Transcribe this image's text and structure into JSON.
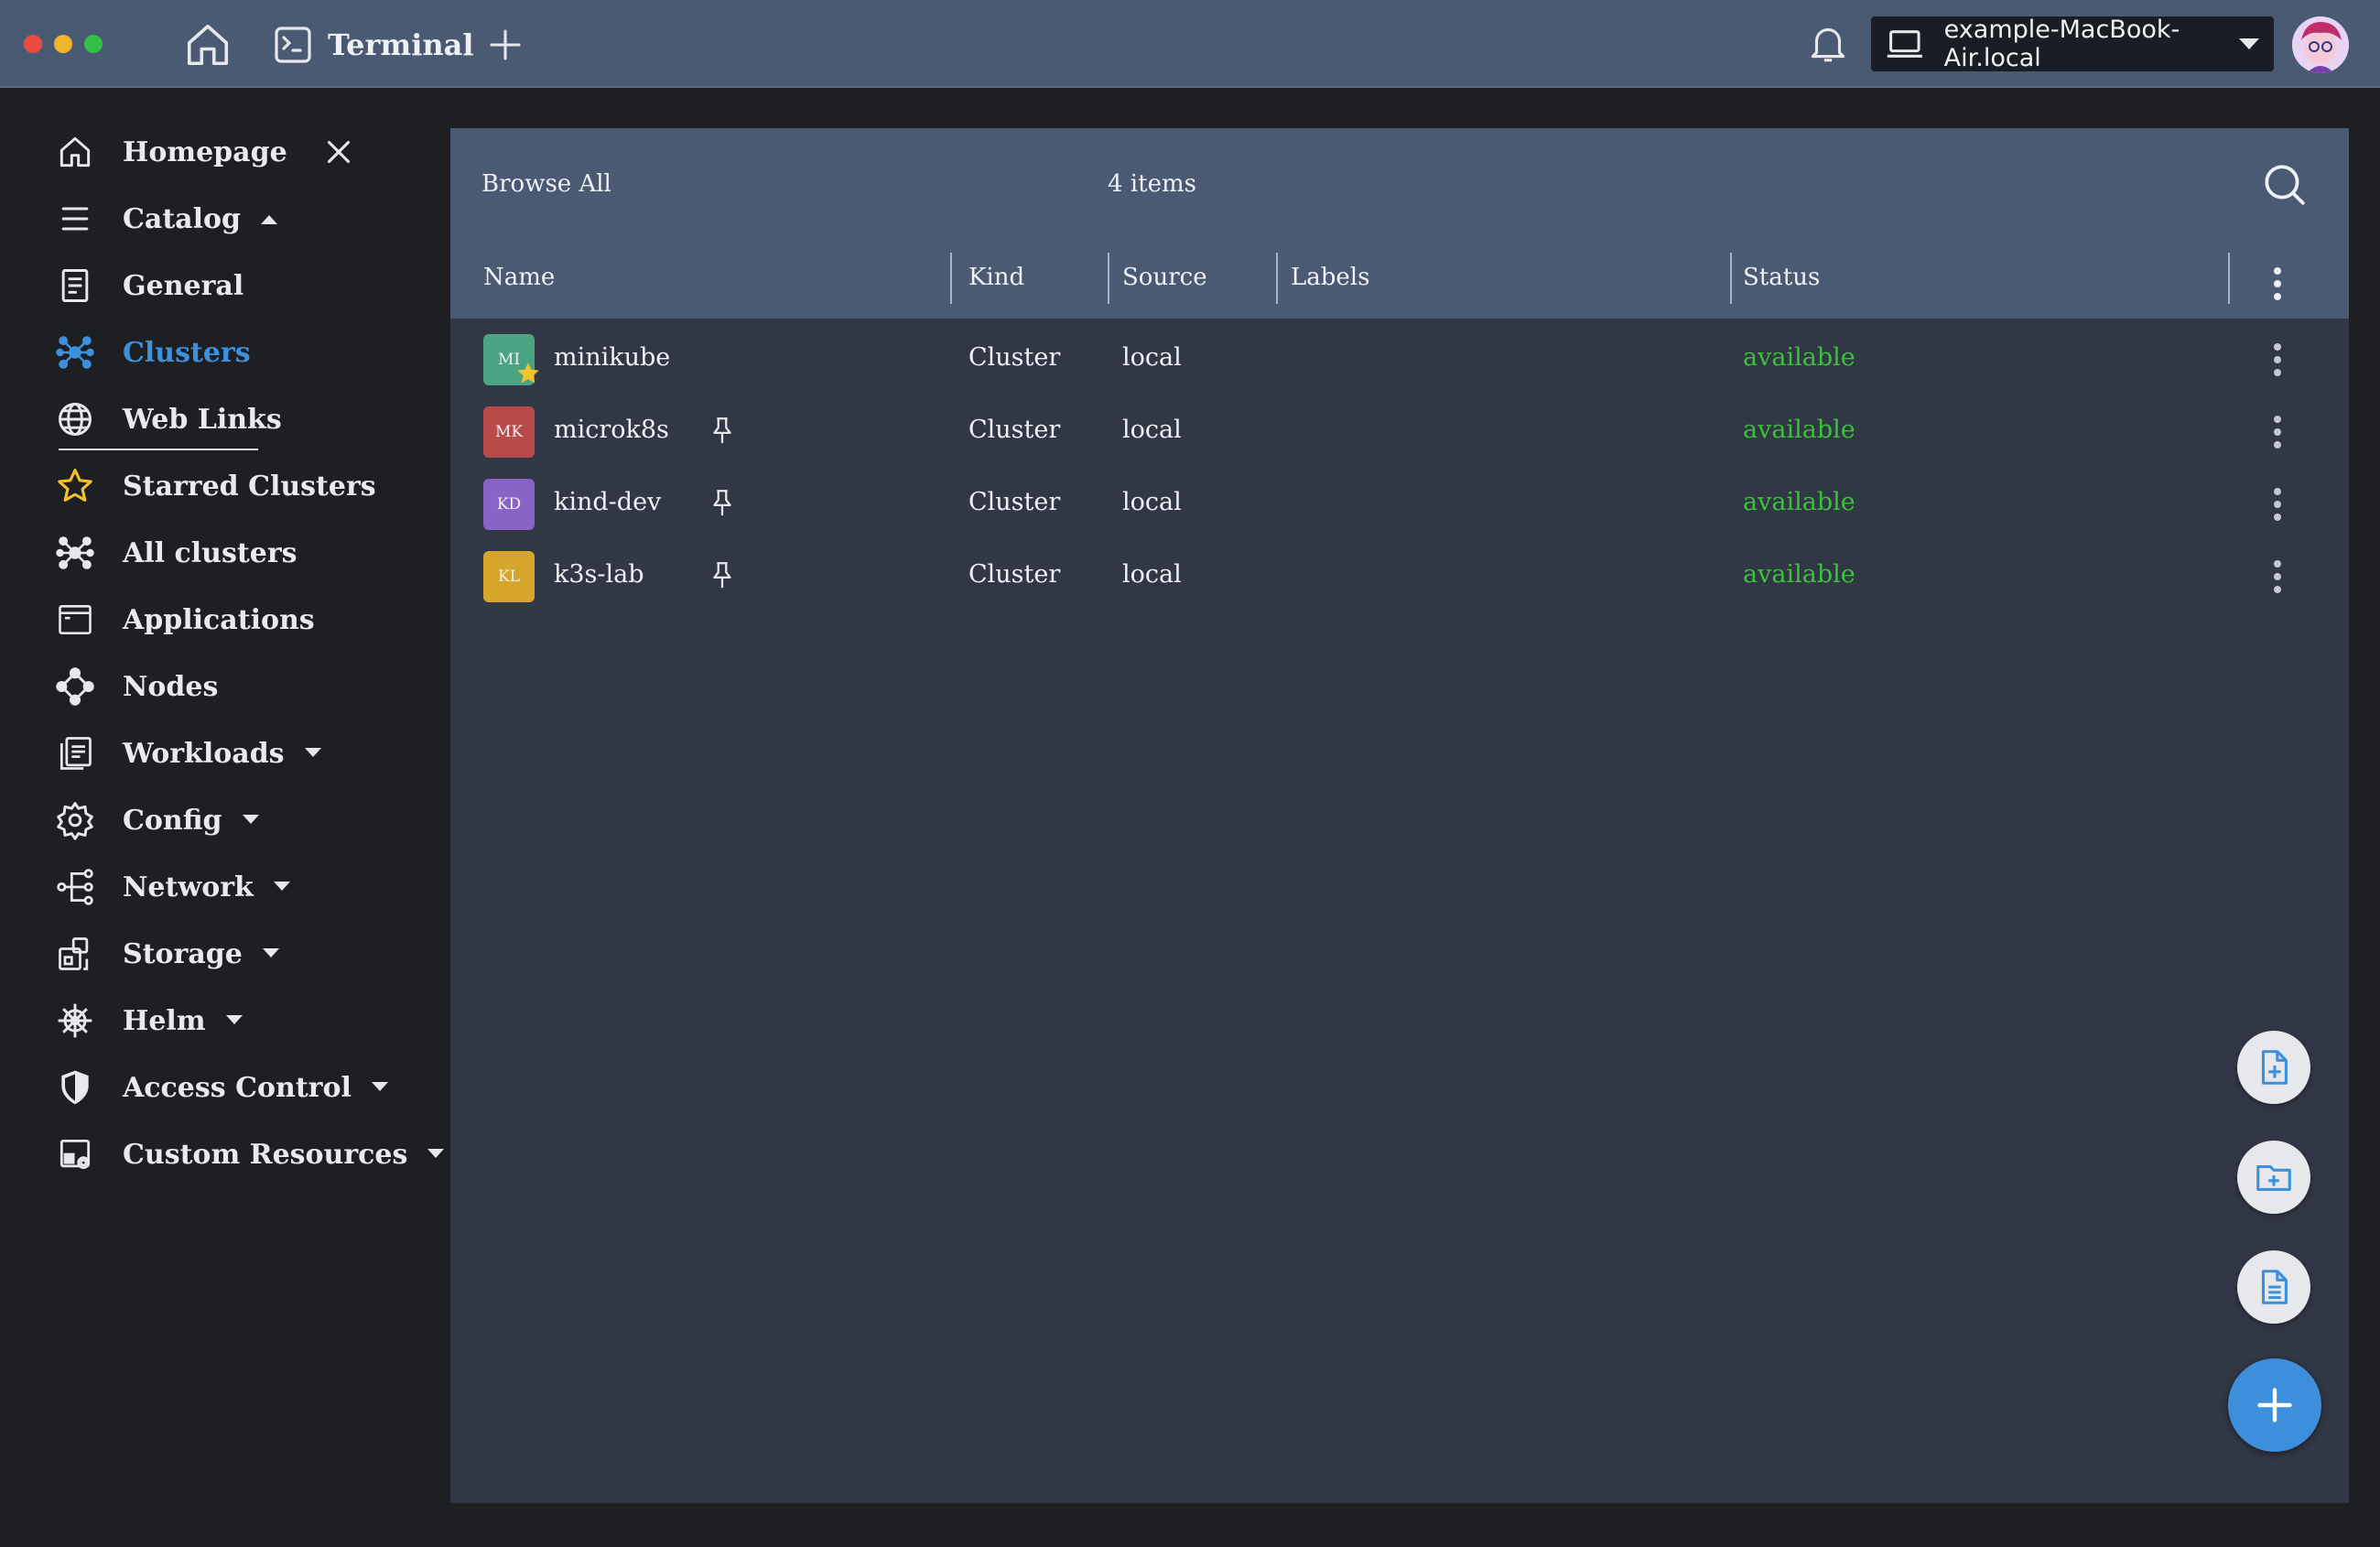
{
  "topbar": {
    "terminal_tab": "Terminal",
    "host": "example-MacBook-Air.local"
  },
  "sidebar": {
    "items": [
      {
        "label": "Homepage",
        "icon": "home-icon",
        "closable": true
      },
      {
        "label": "Catalog",
        "icon": "menu-lines-icon",
        "caret": "up"
      },
      {
        "label": "General",
        "icon": "document-icon"
      },
      {
        "label": "Clusters",
        "icon": "cluster-icon",
        "active": true
      },
      {
        "label": "Web Links",
        "icon": "globe-icon"
      },
      {
        "label": "Starred Clusters",
        "icon": "star-outline-icon"
      },
      {
        "label": "All clusters",
        "icon": "cluster-icon"
      },
      {
        "label": "Applications",
        "icon": "window-icon"
      },
      {
        "label": "Nodes",
        "icon": "nodes-icon"
      },
      {
        "label": "Workloads",
        "icon": "workloads-icon",
        "caret": "down"
      },
      {
        "label": "Config",
        "icon": "config-gear-icon",
        "caret": "down"
      },
      {
        "label": "Network",
        "icon": "network-icon",
        "caret": "down"
      },
      {
        "label": "Storage",
        "icon": "storage-icon",
        "caret": "down"
      },
      {
        "label": "Helm",
        "icon": "helm-icon",
        "caret": "down"
      },
      {
        "label": "Access Control",
        "icon": "shield-icon",
        "caret": "down"
      },
      {
        "label": "Custom Resources",
        "icon": "custom-resources-icon",
        "caret": "down"
      }
    ]
  },
  "browser": {
    "title": "Browse All",
    "count": "4 items",
    "columns": [
      "Name",
      "Kind",
      "Source",
      "Labels",
      "Status"
    ],
    "rows": [
      {
        "initials": "MI",
        "badge_color": "#4aa383",
        "name": "minikube",
        "starred": true,
        "pinned": false,
        "kind": "Cluster",
        "source": "local",
        "labels": "",
        "status": "available"
      },
      {
        "initials": "MK",
        "badge_color": "#b84a4a",
        "name": "microk8s",
        "starred": false,
        "pinned": true,
        "kind": "Cluster",
        "source": "local",
        "labels": "",
        "status": "available"
      },
      {
        "initials": "KD",
        "badge_color": "#8a63c6",
        "name": "kind-dev",
        "starred": false,
        "pinned": true,
        "kind": "Cluster",
        "source": "local",
        "labels": "",
        "status": "available"
      },
      {
        "initials": "KL",
        "badge_color": "#d6a52b",
        "name": "k3s-lab",
        "starred": false,
        "pinned": true,
        "kind": "Cluster",
        "source": "local",
        "labels": "",
        "status": "available"
      }
    ]
  },
  "colors": {
    "accent": "#3d8fdc",
    "status_available": "#3bc23b",
    "star": "#f2c12e"
  }
}
